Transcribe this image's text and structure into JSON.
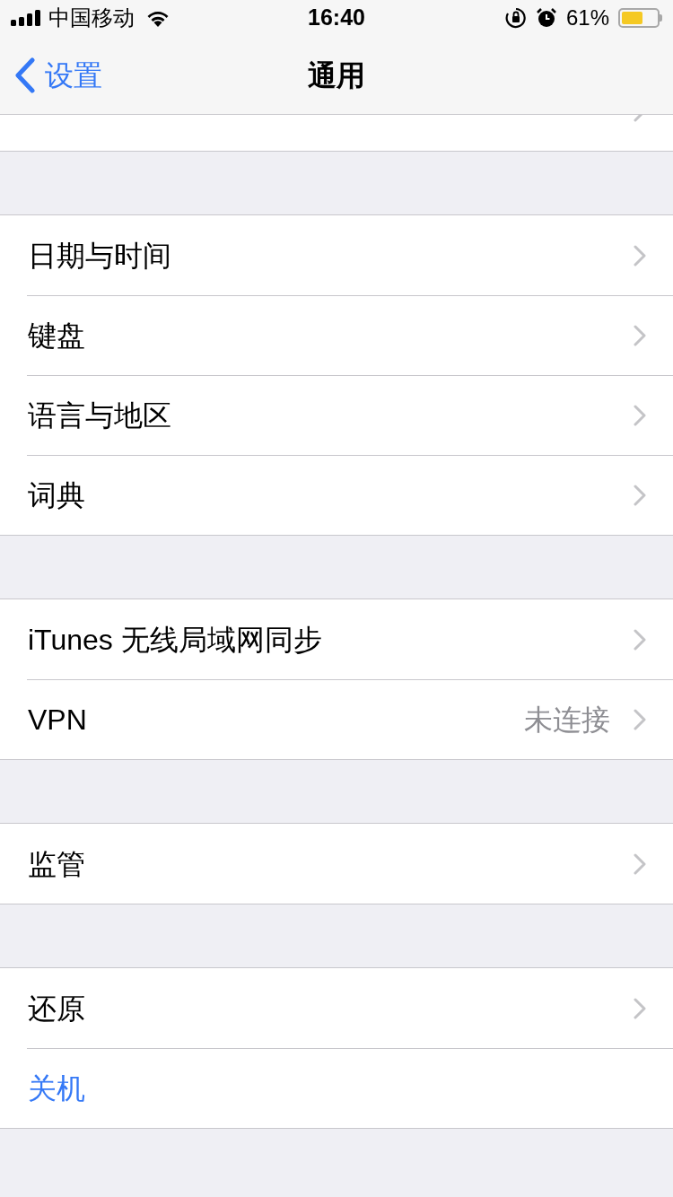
{
  "status_bar": {
    "carrier": "中国移动",
    "time": "16:40",
    "battery": "61%"
  },
  "nav": {
    "back": "设置",
    "title": "通用"
  },
  "groups": [
    {
      "rows": [
        {
          "kind": "link"
        }
      ]
    },
    {
      "rows": [
        {
          "label": "日期与时间",
          "kind": "link"
        },
        {
          "label": "键盘",
          "kind": "link"
        },
        {
          "label": "语言与地区",
          "kind": "link"
        },
        {
          "label": "词典",
          "kind": "link"
        }
      ]
    },
    {
      "rows": [
        {
          "label": "iTunes 无线局域网同步",
          "kind": "link"
        },
        {
          "label": "VPN",
          "value": "未连接",
          "kind": "link"
        }
      ]
    },
    {
      "rows": [
        {
          "label": "监管",
          "kind": "link"
        }
      ]
    },
    {
      "rows": [
        {
          "label": "还原",
          "kind": "link"
        },
        {
          "label": "关机",
          "kind": "action"
        }
      ]
    }
  ]
}
